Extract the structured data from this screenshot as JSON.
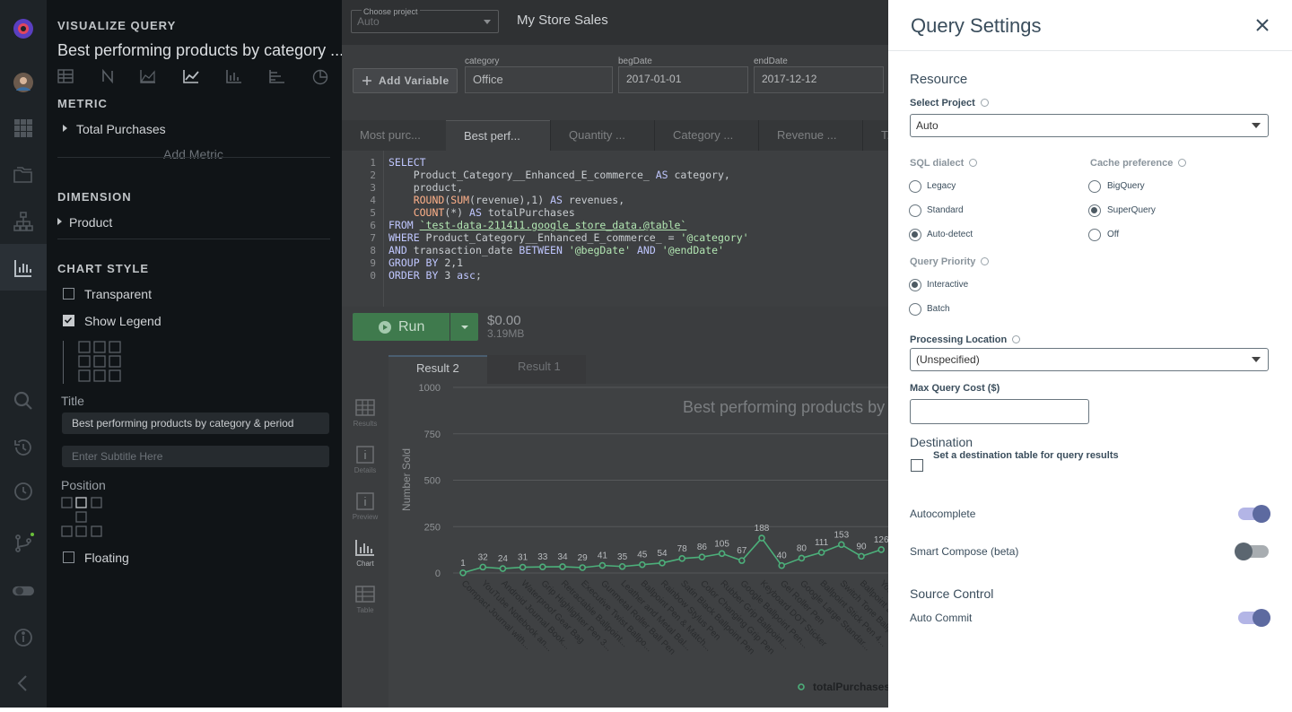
{
  "config_panel": {
    "header": "VISUALIZE QUERY",
    "chart_title": "Best performing products by category ...",
    "metric_label": "METRIC",
    "metric_item": "Total Purchases",
    "add_metric": "Add Metric",
    "dimension_label": "DIMENSION",
    "dimension_item": "Product",
    "chart_style_label": "CHART STYLE",
    "transparent": "Transparent",
    "show_legend": "Show Legend",
    "title_label": "Title",
    "title_value": "Best performing products by category & period",
    "subtitle_placeholder": "Enter Subtitle Here",
    "position_label": "Position",
    "floating": "Floating"
  },
  "topbar": {
    "choose_project_label": "Choose project",
    "choose_project_value": "Auto",
    "app_name": "My Store Sales"
  },
  "variables": {
    "add_variable": "Add Variable",
    "fields": [
      {
        "label": "category",
        "value": "Office"
      },
      {
        "label": "begDate",
        "value": "2017-01-01"
      },
      {
        "label": "endDate",
        "value": "2017-12-12"
      }
    ]
  },
  "query_tabs": [
    "Most purc...",
    "Best perf...",
    "Quantity ...",
    "Category ...",
    "Revenue ...",
    "T..."
  ],
  "editor": {
    "line_numbers": [
      "1",
      "2",
      "3",
      "4",
      "5",
      "6",
      "7",
      "8",
      "9",
      "0"
    ]
  },
  "run_bar": {
    "run": "Run",
    "cost": "$0.00",
    "size": "3.19MB"
  },
  "results": {
    "tabs": [
      "Result 2",
      "Result 1"
    ],
    "side_icons": [
      "Results",
      "Details",
      "Preview",
      "Chart",
      "Table"
    ]
  },
  "chart_data": {
    "type": "line",
    "title": "Best performing products by ca...",
    "ylabel": "Number Sold",
    "ylim": [
      0,
      1000
    ],
    "yticks": [
      0,
      250,
      500,
      750,
      1000
    ],
    "categories": [
      "Compact Journal with...",
      "YouTube Notebook an...",
      "Android Journal Book...",
      "Waterproof Gear Bag",
      "Grip Highlighter Pen 3...",
      "Retractable Ballpoint...",
      "Executive Twist Ballpo...",
      "Gunmetal Roller Ball Pen",
      "Leather and Metal Bal...",
      "Ballpoint Pen & Match...",
      "Rainbow Stylus Pen",
      "Satin Black Ballpoint Pen",
      "Color Changing Grip Pen",
      "Rubber Grip Ballpoint...",
      "Google Ballpoint Pen...",
      "Keyboard DOT Sticker",
      "Gel Roller Pen",
      "Google Large Standar...",
      "Ballpoint Stick Pen 4...",
      "Switch Tone Ballpoint...",
      "Ballpoint LED Light Pen",
      "YouTube..."
    ],
    "series": [
      {
        "name": "totalPurchases",
        "values": [
          1,
          32,
          24,
          31,
          33,
          34,
          29,
          41,
          35,
          45,
          54,
          78,
          86,
          105,
          67,
          188,
          40,
          80,
          111,
          153,
          90,
          126
        ]
      }
    ],
    "colors": {
      "line": "#4caf7a"
    }
  },
  "drawer": {
    "title": "Query Settings",
    "resource": "Resource",
    "select_project": "Select Project",
    "project_value": "Auto",
    "sql_dialect": "SQL dialect",
    "dialect_options": [
      "Legacy",
      "Standard",
      "Auto-detect"
    ],
    "cache_preference": "Cache preference",
    "cache_options": [
      "BigQuery",
      "SuperQuery",
      "Off"
    ],
    "query_priority": "Query Priority",
    "priority_options": [
      "Interactive",
      "Batch"
    ],
    "processing_location": "Processing Location",
    "location_value": "(Unspecified)",
    "max_cost": "Max Query Cost ($)",
    "destination": "Destination",
    "destination_text": "Set a destination table for query results",
    "autocomplete": "Autocomplete",
    "smart_compose": "Smart Compose (beta)",
    "source_control": "Source Control",
    "auto_commit": "Auto Commit"
  }
}
